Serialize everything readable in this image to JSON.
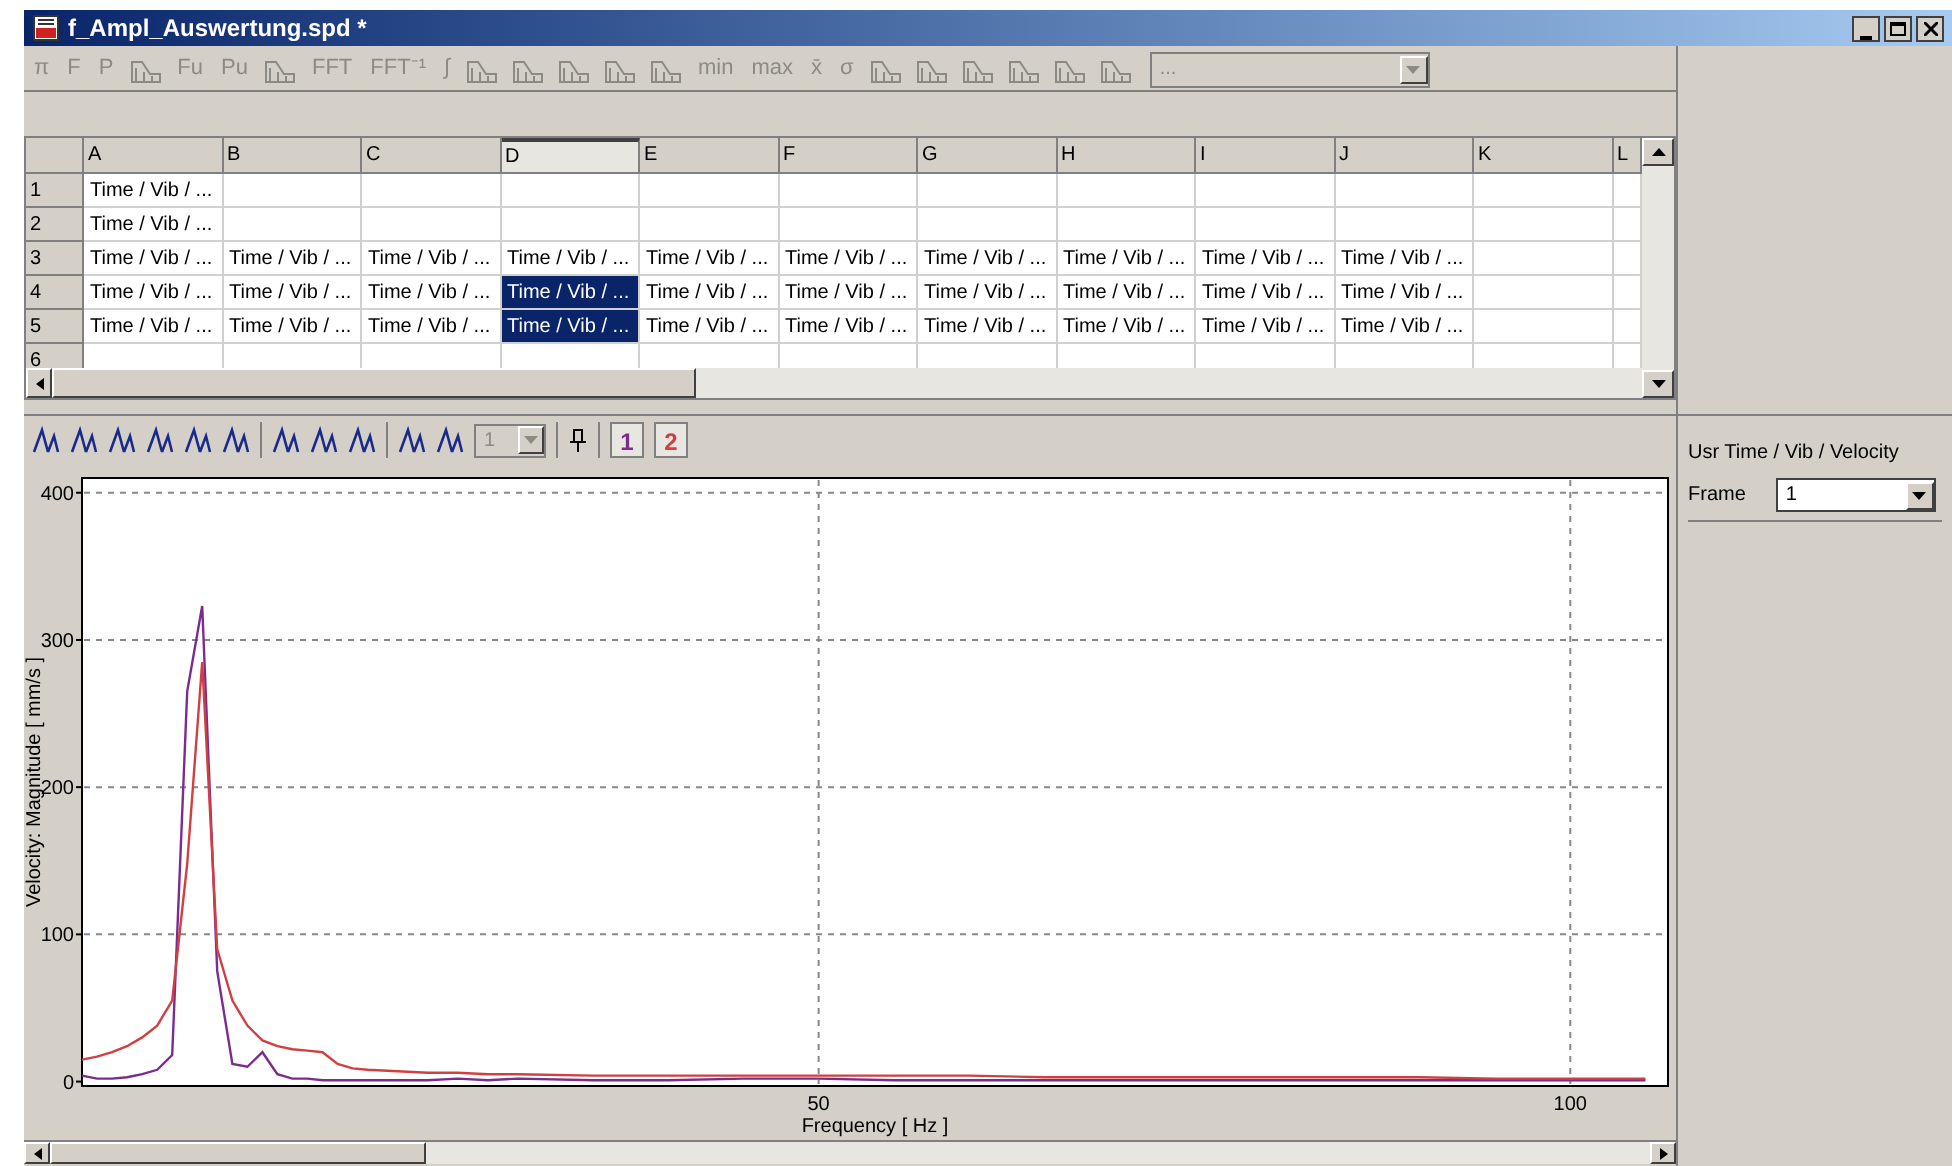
{
  "window": {
    "title": "f_Ampl_Auswertung.spd *"
  },
  "toolbar": {
    "disabled": true,
    "items": [
      {
        "kind": "text",
        "label": "π"
      },
      {
        "kind": "text",
        "label": "F"
      },
      {
        "kind": "text",
        "label": "P"
      },
      {
        "kind": "icon"
      },
      {
        "kind": "text",
        "label": "Fu"
      },
      {
        "kind": "text",
        "label": "Pu"
      },
      {
        "kind": "icon"
      },
      {
        "kind": "text",
        "label": "FFT"
      },
      {
        "kind": "text",
        "label": "FFT⁻¹"
      },
      {
        "kind": "text",
        "label": "∫"
      },
      {
        "kind": "icon"
      },
      {
        "kind": "icon"
      },
      {
        "kind": "icon"
      },
      {
        "kind": "icon"
      },
      {
        "kind": "icon"
      },
      {
        "kind": "text",
        "label": "min"
      },
      {
        "kind": "text",
        "label": "max"
      },
      {
        "kind": "text",
        "label": "x̄"
      },
      {
        "kind": "text",
        "label": "σ"
      },
      {
        "kind": "icon"
      },
      {
        "kind": "icon"
      },
      {
        "kind": "icon"
      },
      {
        "kind": "icon"
      },
      {
        "kind": "icon"
      },
      {
        "kind": "icon"
      }
    ],
    "dropdown": {
      "value": "..."
    }
  },
  "table": {
    "columns": [
      {
        "label": "A",
        "selected": false
      },
      {
        "label": "B",
        "selected": false
      },
      {
        "label": "C",
        "selected": false
      },
      {
        "label": "D",
        "selected": true
      },
      {
        "label": "E",
        "selected": false
      },
      {
        "label": "F",
        "selected": false
      },
      {
        "label": "G",
        "selected": false
      },
      {
        "label": "H",
        "selected": false
      },
      {
        "label": "I",
        "selected": false
      },
      {
        "label": "J",
        "selected": false
      },
      {
        "label": "K",
        "selected": false
      },
      {
        "label": "L",
        "selected": false
      }
    ],
    "rows": [
      {
        "label": "1",
        "cells": [
          {
            "text": "Time / Vib / ...",
            "selected": false
          },
          {
            "selected": false
          },
          {
            "selected": false
          },
          {
            "selected": false
          },
          {
            "selected": false
          },
          {
            "selected": false
          },
          {
            "selected": false
          },
          {
            "selected": false
          },
          {
            "selected": false
          },
          {
            "selected": false
          },
          {
            "selected": false
          },
          {
            "selected": false
          }
        ]
      },
      {
        "label": "2",
        "cells": [
          {
            "text": "Time / Vib / ...",
            "selected": false
          },
          {
            "selected": false
          },
          {
            "selected": false
          },
          {
            "selected": false
          },
          {
            "selected": false
          },
          {
            "selected": false
          },
          {
            "selected": false
          },
          {
            "selected": false
          },
          {
            "selected": false
          },
          {
            "selected": false
          },
          {
            "selected": false
          },
          {
            "selected": false
          }
        ]
      },
      {
        "label": "3",
        "cells": [
          {
            "text": "Time / Vib / ...",
            "selected": false
          },
          {
            "text": "Time / Vib / ...",
            "selected": false
          },
          {
            "text": "Time / Vib / ...",
            "selected": false
          },
          {
            "text": "Time / Vib / ...",
            "selected": false
          },
          {
            "text": "Time / Vib / ...",
            "selected": false
          },
          {
            "text": "Time / Vib / ...",
            "selected": false
          },
          {
            "text": "Time / Vib / ...",
            "selected": false
          },
          {
            "text": "Time / Vib / ...",
            "selected": false
          },
          {
            "text": "Time / Vib / ...",
            "selected": false
          },
          {
            "text": "Time / Vib / ...",
            "selected": false
          },
          {
            "selected": false
          },
          {
            "selected": false
          }
        ]
      },
      {
        "label": "4",
        "cells": [
          {
            "text": "Time / Vib / ...",
            "selected": false
          },
          {
            "text": "Time / Vib / ...",
            "selected": false
          },
          {
            "text": "Time / Vib / ...",
            "selected": false
          },
          {
            "text": "Time / Vib / ...",
            "selected": true
          },
          {
            "text": "Time / Vib / ...",
            "selected": false
          },
          {
            "text": "Time / Vib / ...",
            "selected": false
          },
          {
            "text": "Time / Vib / ...",
            "selected": false
          },
          {
            "text": "Time / Vib / ...",
            "selected": false
          },
          {
            "text": "Time / Vib / ...",
            "selected": false
          },
          {
            "text": "Time / Vib / ...",
            "selected": false
          },
          {
            "selected": false
          },
          {
            "selected": false
          }
        ]
      },
      {
        "label": "5",
        "cells": [
          {
            "text": "Time / Vib / ...",
            "selected": false
          },
          {
            "text": "Time / Vib / ...",
            "selected": false
          },
          {
            "text": "Time / Vib / ...",
            "selected": false
          },
          {
            "text": "Time / Vib / ...",
            "selected": true
          },
          {
            "text": "Time / Vib / ...",
            "selected": false
          },
          {
            "text": "Time / Vib / ...",
            "selected": false
          },
          {
            "text": "Time / Vib / ...",
            "selected": false
          },
          {
            "text": "Time / Vib / ...",
            "selected": false
          },
          {
            "text": "Time / Vib / ...",
            "selected": false
          },
          {
            "text": "Time / Vib / ...",
            "selected": false
          },
          {
            "selected": false
          },
          {
            "selected": false
          }
        ]
      },
      {
        "label": "6",
        "cells": [
          {
            "selected": false
          },
          {
            "selected": false
          },
          {
            "selected": false
          },
          {
            "selected": false
          },
          {
            "selected": false
          },
          {
            "selected": false
          },
          {
            "selected": false
          },
          {
            "selected": false
          },
          {
            "selected": false
          },
          {
            "selected": false
          },
          {
            "selected": false
          },
          {
            "selected": false
          }
        ]
      }
    ]
  },
  "chart_toolbar": {
    "items": [
      {
        "kind": "icon"
      },
      {
        "kind": "icon"
      },
      {
        "kind": "icon"
      },
      {
        "kind": "icon"
      },
      {
        "kind": "icon"
      },
      {
        "kind": "icon"
      },
      {
        "kind": "icon"
      },
      {
        "kind": "icon"
      },
      {
        "kind": "icon"
      },
      {
        "kind": "icon"
      },
      {
        "kind": "icon"
      }
    ],
    "dropdown": {
      "value": "1",
      "disabled": true
    }
  },
  "chart": {
    "chart_data": {
      "type": "line",
      "grid": true,
      "xlabel": "Frequency [ Hz ]",
      "ylabel": "Velocity: Magnitude [ mm/s ]",
      "xlim": [
        1,
        106.5
      ],
      "ylim": [
        -3,
        410
      ],
      "xticks": [
        50,
        100
      ],
      "yticks": [
        0,
        100,
        200,
        300,
        400
      ],
      "x": [
        1,
        2,
        3,
        4,
        5,
        6,
        7,
        8,
        9,
        10,
        11,
        12,
        13,
        14,
        15,
        16,
        17,
        18,
        19,
        20,
        22,
        24,
        26,
        28,
        30,
        35,
        40,
        45,
        50,
        55,
        60,
        65,
        70,
        75,
        80,
        85,
        90,
        95,
        100,
        105
      ],
      "series": [
        {
          "name": "1",
          "color": "#7b2d8e",
          "values": [
            4,
            2,
            2,
            3,
            5,
            8,
            18,
            265,
            323,
            75,
            12,
            10,
            20,
            5,
            2,
            2,
            1,
            1,
            1,
            1,
            1,
            1,
            2,
            1,
            2,
            1,
            1,
            2,
            2,
            1,
            1,
            1,
            1,
            1,
            1,
            1,
            1,
            1,
            1,
            1
          ]
        },
        {
          "name": "2",
          "color": "#d04040",
          "values": [
            15,
            17,
            20,
            24,
            30,
            38,
            55,
            148,
            285,
            90,
            55,
            38,
            28,
            24,
            22,
            21,
            20,
            12,
            9,
            8,
            7,
            6,
            6,
            5,
            5,
            4,
            4,
            4,
            4,
            4,
            4,
            3,
            3,
            3,
            3,
            3,
            3,
            2,
            2,
            2
          ]
        }
      ]
    }
  },
  "side_panel": {
    "title": "Usr Time / Vib / Velocity",
    "frame_label": "Frame",
    "frame_value": "1"
  }
}
